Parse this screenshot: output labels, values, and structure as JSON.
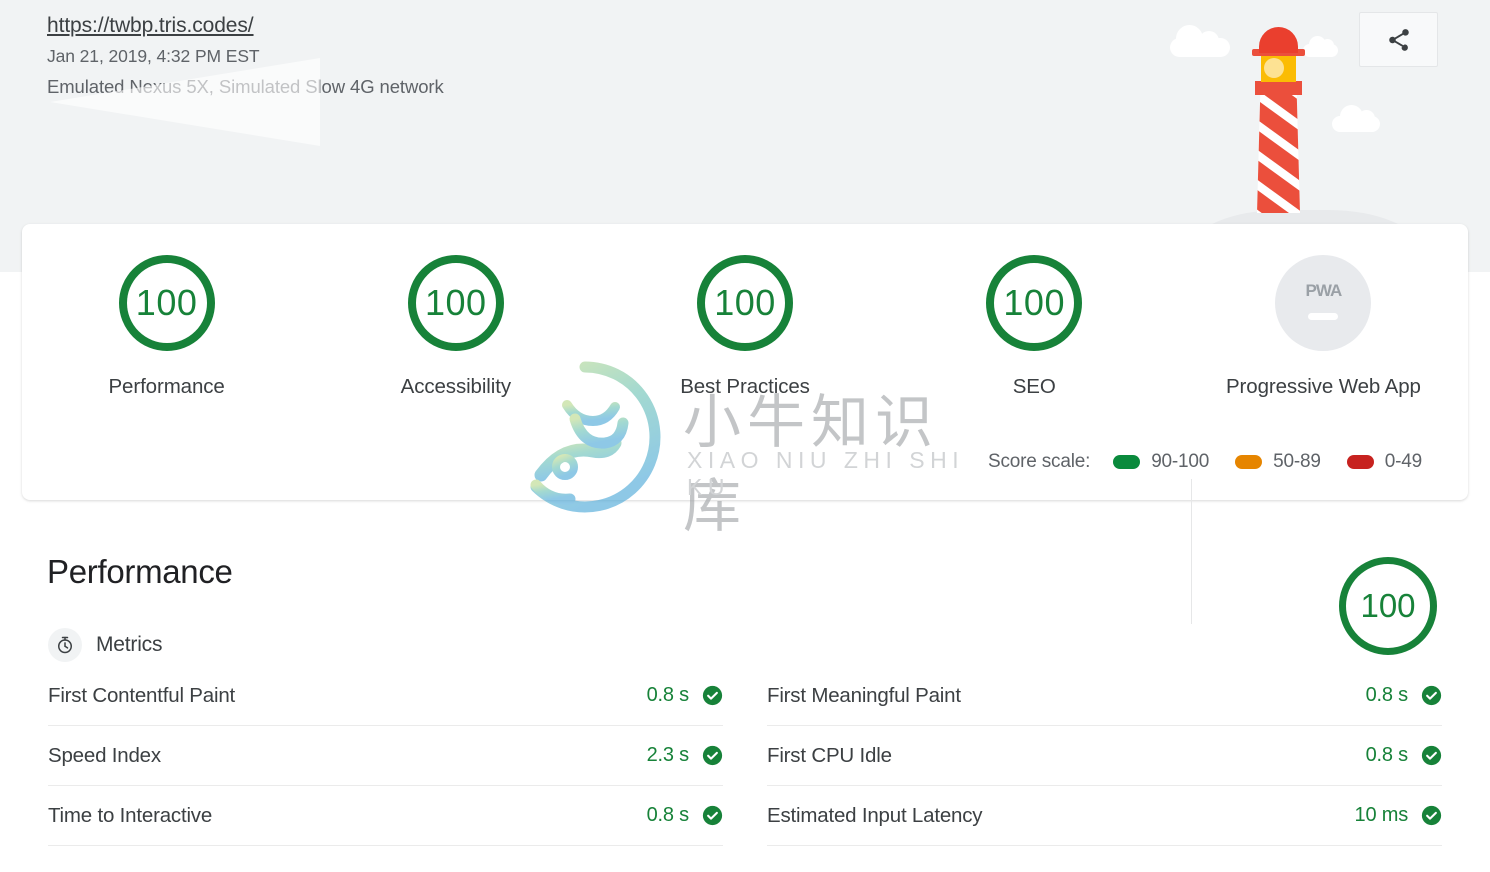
{
  "header": {
    "url": "https://twbp.tris.codes/",
    "timestamp": "Jan 21, 2019, 4:32 PM EST",
    "environment": "Emulated Nexus 5X, Simulated Slow 4G network",
    "share_icon": "share-icon",
    "illustration": "lighthouse-illustration"
  },
  "scores": {
    "categories": [
      {
        "label": "Performance",
        "score": "100",
        "color": "#178239"
      },
      {
        "label": "Accessibility",
        "score": "100",
        "color": "#178239"
      },
      {
        "label": "Best Practices",
        "score": "100",
        "color": "#178239"
      },
      {
        "label": "SEO",
        "score": "100",
        "color": "#178239"
      }
    ],
    "pwa": {
      "label": "Progressive Web App",
      "badge_text": "PWA"
    },
    "scale": {
      "label": "Score scale:",
      "items": [
        {
          "range": "90-100",
          "color": "#0a8a3c"
        },
        {
          "range": "50-89",
          "color": "#e68500"
        },
        {
          "range": "0-49",
          "color": "#c7221f"
        }
      ]
    }
  },
  "watermark": {
    "chinese": "小牛知识库",
    "pinyin": "XIAO NIU ZHI SHI KU",
    "logo": "ox-circle-logo"
  },
  "performance": {
    "title": "Performance",
    "score": "100",
    "metrics_heading": "Metrics",
    "metrics_icon": "stopwatch-icon",
    "left_column": [
      {
        "name": "First Contentful Paint",
        "value": "0.8 s",
        "status": "pass"
      },
      {
        "name": "Speed Index",
        "value": "2.3 s",
        "status": "pass"
      },
      {
        "name": "Time to Interactive",
        "value": "0.8 s",
        "status": "pass"
      }
    ],
    "right_column": [
      {
        "name": "First Meaningful Paint",
        "value": "0.8 s",
        "status": "pass"
      },
      {
        "name": "First CPU Idle",
        "value": "0.8 s",
        "status": "pass"
      },
      {
        "name": "Estimated Input Latency",
        "value": "10 ms",
        "status": "pass"
      }
    ]
  }
}
